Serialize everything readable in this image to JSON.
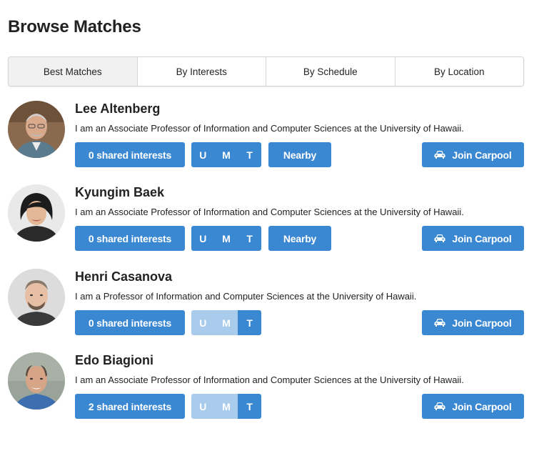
{
  "page": {
    "title": "Browse Matches"
  },
  "tabs": [
    {
      "label": "Best Matches",
      "active": true
    },
    {
      "label": "By Interests",
      "active": false
    },
    {
      "label": "By Schedule",
      "active": false
    },
    {
      "label": "By Location",
      "active": false
    }
  ],
  "colors": {
    "accent": "#3a87d2",
    "accent_muted": "#a9cbec",
    "tab_active_bg": "#f1f1f1"
  },
  "matches": [
    {
      "name": "Lee Altenberg",
      "bio": "I am an Associate Professor of Information and Computer Sciences at the University of Hawaii.",
      "interests_label": "0 shared interests",
      "days": [
        {
          "label": "U",
          "active": true
        },
        {
          "label": "M",
          "active": true
        },
        {
          "label": "T",
          "active": true
        }
      ],
      "nearby_label": "Nearby",
      "carpool_label": "Join Carpool"
    },
    {
      "name": "Kyungim Baek",
      "bio": "I am an Associate Professor of Information and Computer Sciences at the University of Hawaii.",
      "interests_label": "0 shared interests",
      "days": [
        {
          "label": "U",
          "active": true
        },
        {
          "label": "M",
          "active": true
        },
        {
          "label": "T",
          "active": true
        }
      ],
      "nearby_label": "Nearby",
      "carpool_label": "Join Carpool"
    },
    {
      "name": "Henri Casanova",
      "bio": "I am a Professor of Information and Computer Sciences at the University of Hawaii.",
      "interests_label": "0 shared interests",
      "days": [
        {
          "label": "U",
          "active": false
        },
        {
          "label": "M",
          "active": false
        },
        {
          "label": "T",
          "active": true
        }
      ],
      "carpool_label": "Join Carpool"
    },
    {
      "name": "Edo Biagioni",
      "bio": "I am an Associate Professor of Information and Computer Sciences at the University of Hawaii.",
      "interests_label": "2 shared interests",
      "days": [
        {
          "label": "U",
          "active": false
        },
        {
          "label": "M",
          "active": false
        },
        {
          "label": "T",
          "active": true
        }
      ],
      "carpool_label": "Join Carpool"
    }
  ],
  "icons": {
    "carpool": "car-icon"
  }
}
